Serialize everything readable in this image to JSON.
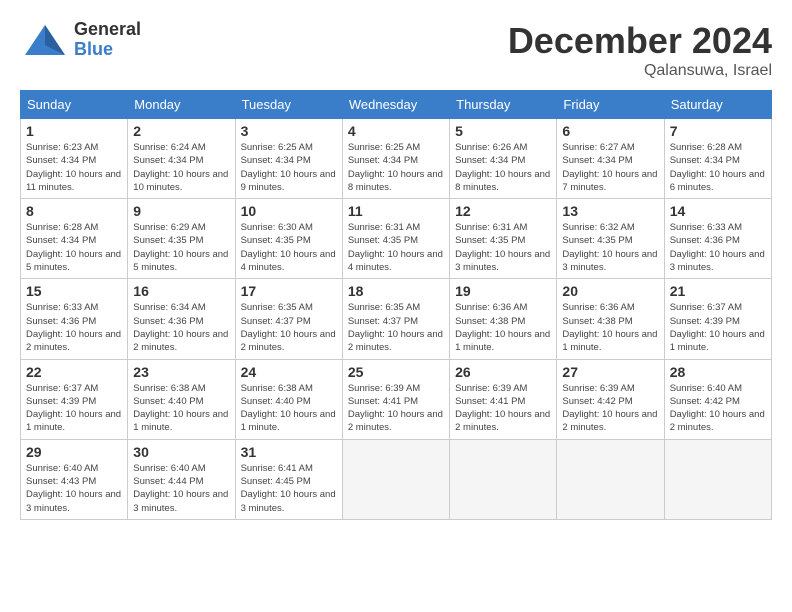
{
  "header": {
    "logo_general": "General",
    "logo_blue": "Blue",
    "month_title": "December 2024",
    "location": "Qalansuwa, Israel"
  },
  "days_of_week": [
    "Sunday",
    "Monday",
    "Tuesday",
    "Wednesday",
    "Thursday",
    "Friday",
    "Saturday"
  ],
  "weeks": [
    [
      {
        "day": "1",
        "sunrise": "6:23 AM",
        "sunset": "4:34 PM",
        "daylight": "10 hours and 11 minutes."
      },
      {
        "day": "2",
        "sunrise": "6:24 AM",
        "sunset": "4:34 PM",
        "daylight": "10 hours and 10 minutes."
      },
      {
        "day": "3",
        "sunrise": "6:25 AM",
        "sunset": "4:34 PM",
        "daylight": "10 hours and 9 minutes."
      },
      {
        "day": "4",
        "sunrise": "6:25 AM",
        "sunset": "4:34 PM",
        "daylight": "10 hours and 8 minutes."
      },
      {
        "day": "5",
        "sunrise": "6:26 AM",
        "sunset": "4:34 PM",
        "daylight": "10 hours and 8 minutes."
      },
      {
        "day": "6",
        "sunrise": "6:27 AM",
        "sunset": "4:34 PM",
        "daylight": "10 hours and 7 minutes."
      },
      {
        "day": "7",
        "sunrise": "6:28 AM",
        "sunset": "4:34 PM",
        "daylight": "10 hours and 6 minutes."
      }
    ],
    [
      {
        "day": "8",
        "sunrise": "6:28 AM",
        "sunset": "4:34 PM",
        "daylight": "10 hours and 5 minutes."
      },
      {
        "day": "9",
        "sunrise": "6:29 AM",
        "sunset": "4:35 PM",
        "daylight": "10 hours and 5 minutes."
      },
      {
        "day": "10",
        "sunrise": "6:30 AM",
        "sunset": "4:35 PM",
        "daylight": "10 hours and 4 minutes."
      },
      {
        "day": "11",
        "sunrise": "6:31 AM",
        "sunset": "4:35 PM",
        "daylight": "10 hours and 4 minutes."
      },
      {
        "day": "12",
        "sunrise": "6:31 AM",
        "sunset": "4:35 PM",
        "daylight": "10 hours and 3 minutes."
      },
      {
        "day": "13",
        "sunrise": "6:32 AM",
        "sunset": "4:35 PM",
        "daylight": "10 hours and 3 minutes."
      },
      {
        "day": "14",
        "sunrise": "6:33 AM",
        "sunset": "4:36 PM",
        "daylight": "10 hours and 3 minutes."
      }
    ],
    [
      {
        "day": "15",
        "sunrise": "6:33 AM",
        "sunset": "4:36 PM",
        "daylight": "10 hours and 2 minutes."
      },
      {
        "day": "16",
        "sunrise": "6:34 AM",
        "sunset": "4:36 PM",
        "daylight": "10 hours and 2 minutes."
      },
      {
        "day": "17",
        "sunrise": "6:35 AM",
        "sunset": "4:37 PM",
        "daylight": "10 hours and 2 minutes."
      },
      {
        "day": "18",
        "sunrise": "6:35 AM",
        "sunset": "4:37 PM",
        "daylight": "10 hours and 2 minutes."
      },
      {
        "day": "19",
        "sunrise": "6:36 AM",
        "sunset": "4:38 PM",
        "daylight": "10 hours and 1 minute."
      },
      {
        "day": "20",
        "sunrise": "6:36 AM",
        "sunset": "4:38 PM",
        "daylight": "10 hours and 1 minute."
      },
      {
        "day": "21",
        "sunrise": "6:37 AM",
        "sunset": "4:39 PM",
        "daylight": "10 hours and 1 minute."
      }
    ],
    [
      {
        "day": "22",
        "sunrise": "6:37 AM",
        "sunset": "4:39 PM",
        "daylight": "10 hours and 1 minute."
      },
      {
        "day": "23",
        "sunrise": "6:38 AM",
        "sunset": "4:40 PM",
        "daylight": "10 hours and 1 minute."
      },
      {
        "day": "24",
        "sunrise": "6:38 AM",
        "sunset": "4:40 PM",
        "daylight": "10 hours and 1 minute."
      },
      {
        "day": "25",
        "sunrise": "6:39 AM",
        "sunset": "4:41 PM",
        "daylight": "10 hours and 2 minutes."
      },
      {
        "day": "26",
        "sunrise": "6:39 AM",
        "sunset": "4:41 PM",
        "daylight": "10 hours and 2 minutes."
      },
      {
        "day": "27",
        "sunrise": "6:39 AM",
        "sunset": "4:42 PM",
        "daylight": "10 hours and 2 minutes."
      },
      {
        "day": "28",
        "sunrise": "6:40 AM",
        "sunset": "4:42 PM",
        "daylight": "10 hours and 2 minutes."
      }
    ],
    [
      {
        "day": "29",
        "sunrise": "6:40 AM",
        "sunset": "4:43 PM",
        "daylight": "10 hours and 3 minutes."
      },
      {
        "day": "30",
        "sunrise": "6:40 AM",
        "sunset": "4:44 PM",
        "daylight": "10 hours and 3 minutes."
      },
      {
        "day": "31",
        "sunrise": "6:41 AM",
        "sunset": "4:45 PM",
        "daylight": "10 hours and 3 minutes."
      },
      null,
      null,
      null,
      null
    ]
  ]
}
